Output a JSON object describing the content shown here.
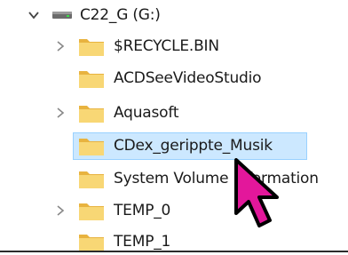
{
  "drive": {
    "label": "C22_G (G:)",
    "icon": "drive-icon",
    "expanded": true
  },
  "folders": [
    {
      "label": "$RECYCLE.BIN",
      "icon": "folder-icon",
      "has_children": true,
      "selected": false
    },
    {
      "label": "ACDSeeVideoStudio",
      "icon": "folder-icon",
      "has_children": false,
      "selected": false
    },
    {
      "label": "Aquasoft",
      "icon": "folder-icon",
      "has_children": true,
      "selected": false
    },
    {
      "label": "CDex_gerippte_Musik",
      "icon": "folder-icon",
      "has_children": false,
      "selected": true
    },
    {
      "label": "System Volume Information",
      "icon": "folder-icon",
      "has_children": false,
      "selected": false
    },
    {
      "label": "TEMP_0",
      "icon": "folder-icon",
      "has_children": true,
      "selected": false
    },
    {
      "label": "TEMP_1",
      "icon": "folder-icon",
      "has_children": false,
      "selected": false
    }
  ],
  "colors": {
    "folder_body": "#f8d775",
    "folder_tab": "#e8b33f",
    "selection_bg": "#cce8ff",
    "selection_border": "#99d1ff",
    "cursor_fill": "#e3179b",
    "cursor_outline": "#000000"
  },
  "overlay": {
    "cursor_icon": "pointer-arrow-icon"
  }
}
